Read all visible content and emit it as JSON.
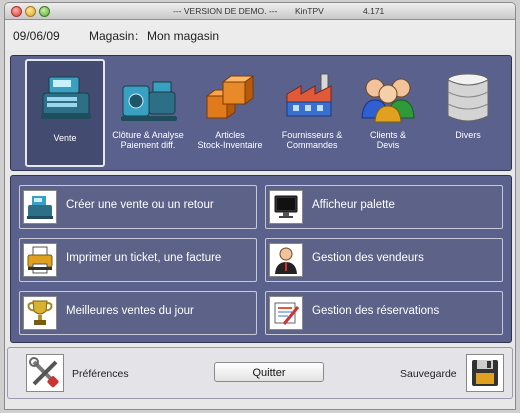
{
  "window": {
    "title_left": "--- VERSION DE DEMO. ---",
    "title_app": "KinTPV",
    "title_version": "4.171"
  },
  "info": {
    "date": "09/06/09",
    "store_label": "Magasin",
    "store_sep": ":",
    "store_name": "Mon magasin"
  },
  "modules": [
    {
      "label": "Vente",
      "icon": "cash-register-icon",
      "selected": true
    },
    {
      "label": "Clôture & Analyse\nPaiement diff.",
      "icon": "safe-register-icon",
      "selected": false
    },
    {
      "label": "Articles\nStock-Inventaire",
      "icon": "boxes-icon",
      "selected": false
    },
    {
      "label": "Fournisseurs &\nCommandes",
      "icon": "factory-icon",
      "selected": false
    },
    {
      "label": "Clients &\nDevis",
      "icon": "clients-icon",
      "selected": false
    },
    {
      "label": "Divers",
      "icon": "database-icon",
      "selected": false
    }
  ],
  "actions": [
    {
      "label": "Créer une vente ou un retour",
      "icon": "cash-register-icon"
    },
    {
      "label": "Afficheur palette",
      "icon": "monitor-icon"
    },
    {
      "label": "Imprimer un ticket, une facture",
      "icon": "printer-icon"
    },
    {
      "label": "Gestion des vendeurs",
      "icon": "seller-icon"
    },
    {
      "label": "Meilleures ventes du jour",
      "icon": "trophy-icon"
    },
    {
      "label": "Gestion des réservations",
      "icon": "reservation-icon"
    }
  ],
  "bottom": {
    "preferences_label": "Préférences",
    "quit_label": "Quitter",
    "backup_label": "Sauvegarde"
  },
  "colors": {
    "panel": "#5a618c",
    "button": "#5d6388"
  }
}
